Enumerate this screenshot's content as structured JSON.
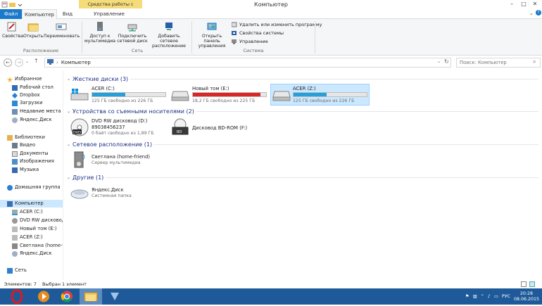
{
  "window": {
    "title": "Компьютер",
    "context_tab": "Средства работы с дисками"
  },
  "tabs": {
    "file": "Файл",
    "computer": "Компьютер",
    "view": "Вид",
    "manage": "Управление"
  },
  "ribbon": {
    "properties": "Свойства",
    "open": "Открыть",
    "rename": "Переименовать",
    "group_location": "Расположение",
    "media_access": "Доступ к мультимедиа",
    "map_drive": "Подключить сетевой диск",
    "add_network_location": "Добавить сетевое расположение",
    "group_network": "Сеть",
    "open_control_panel": "Открыть панель управления",
    "uninstall_program": "Удалить или изменить программу",
    "system_properties": "Свойства системы",
    "manage": "Управление",
    "group_system": "Система"
  },
  "address": {
    "path": "Компьютер",
    "search_placeholder": "Поиск: Компьютер"
  },
  "nav": {
    "favorites": "Избранное",
    "desktop": "Рабочий стол",
    "dropbox": "Dropbox",
    "downloads": "Загрузки",
    "recent": "Недавние места",
    "yandex_disk": "Яндекс.Диск",
    "libraries": "Библиотеки",
    "video": "Видео",
    "documents": "Документы",
    "images": "Изображения",
    "music": "Музыка",
    "homegroup": "Домашняя группа",
    "computer": "Компьютер",
    "acer_c": "ACER (C:)",
    "dvd_rw": "DVD RW дисковод (",
    "new_volume_e": "Новый том (E:)",
    "acer_z": "ACER (Z:)",
    "svetlana": "Светлана (home-frie",
    "yandex_disk2": "Яндекс.Диск",
    "network": "Сеть"
  },
  "sections": {
    "hard_drives": "Жесткие диски (3)",
    "removable": "Устройства со съемными носителями (2)",
    "network": "Сетевое расположение (1)",
    "other": "Другие (1)"
  },
  "drives": [
    {
      "name": "ACER (C:)",
      "free": "125 ГБ свободно из 226 ГБ",
      "used_fraction": 0.45,
      "bar_color": "#26a0da"
    },
    {
      "name": "Новый том (E:)",
      "free": "18,2 ГБ свободно из 225 ГБ",
      "used_fraction": 0.92,
      "bar_color": "#da2626"
    },
    {
      "name": "ACER (Z:)",
      "free": "125 ГБ свободно из 226 ГБ",
      "used_fraction": 0.45,
      "bar_color": "#26a0da"
    }
  ],
  "removable": [
    {
      "name": "DVD RW дисковод (D:)",
      "line2": "89038456237",
      "line3": "0 байт свободно из 1,89 ГБ"
    },
    {
      "name": "Дисковод BD-ROM (F:)"
    }
  ],
  "network_items": [
    {
      "name": "Светлана (home-friend)",
      "sub": "Сервер мультимедиа"
    }
  ],
  "other_items": [
    {
      "name": "Яндекс.Диск",
      "sub": "Системная папка"
    }
  ],
  "status": {
    "count": "Элементов: 7",
    "selected": "Выбран 1 элемент"
  },
  "tray": {
    "lang": "РУС",
    "time": "20:28",
    "date": "08.06.2015"
  }
}
